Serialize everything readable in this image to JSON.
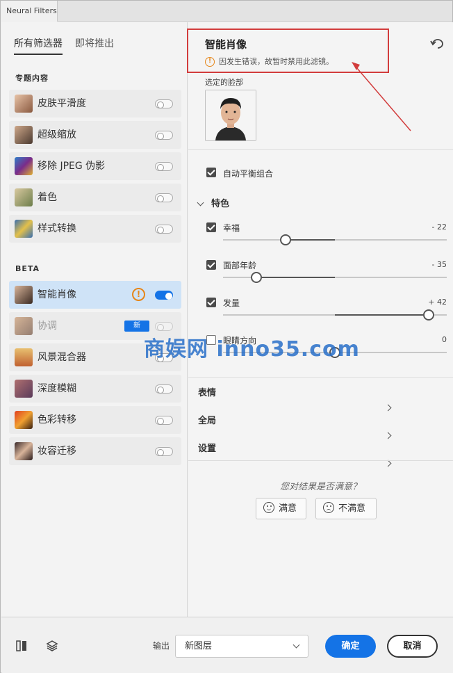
{
  "window": {
    "tab_title": "Neural Filters"
  },
  "left_panel": {
    "tabs": [
      {
        "label": "所有筛选器"
      },
      {
        "label": "即将推出"
      }
    ],
    "featured_label": "专题内容",
    "featured": [
      {
        "label": "皮肤平滑度",
        "enabled": false
      },
      {
        "label": "超级缩放",
        "enabled": false
      },
      {
        "label": "移除 JPEG 伪影",
        "enabled": false
      },
      {
        "label": "着色",
        "enabled": false
      },
      {
        "label": "样式转换",
        "enabled": false
      }
    ],
    "beta_label": "BETA",
    "beta": [
      {
        "label": "智能肖像",
        "enabled": true,
        "warning": "!"
      },
      {
        "label": "协调",
        "enabled": false,
        "badge": "新"
      },
      {
        "label": "风景混合器",
        "enabled": false
      },
      {
        "label": "深度模糊",
        "enabled": false
      },
      {
        "label": "色彩转移",
        "enabled": false
      },
      {
        "label": "妆容迁移",
        "enabled": false
      }
    ]
  },
  "right_panel": {
    "title": "智能肖像",
    "error_icon": "!",
    "error_text": "因发生错误，故暂时禁用此滤镜。",
    "selected_face_label": "选定的脸部",
    "auto_balance_label": "自动平衡组合",
    "section_featured": "特色",
    "sliders": [
      {
        "label": "幸福",
        "value": "- 22",
        "checked": true,
        "level": -22
      },
      {
        "label": "面部年龄",
        "value": "- 35",
        "checked": true,
        "level": -35
      },
      {
        "label": "发量",
        "value": "+ 42",
        "checked": true,
        "level": 42
      },
      {
        "label": "眼睛方向",
        "value": "0",
        "checked": false,
        "level": 0
      }
    ],
    "collapsed_sections": [
      "表情",
      "全局",
      "设置"
    ],
    "feedback_question": "您对结果是否满意？",
    "satisfied_label": "满意",
    "unsatisfied_label": "不满意"
  },
  "footer": {
    "output_label": "输出",
    "output_value": "新图层",
    "ok_label": "确定",
    "cancel_label": "取消"
  },
  "watermark": "商娱网 inno35.com",
  "colors": {
    "accent": "#1473e6",
    "warning": "#e68619",
    "annotation": "#d23c3c"
  }
}
